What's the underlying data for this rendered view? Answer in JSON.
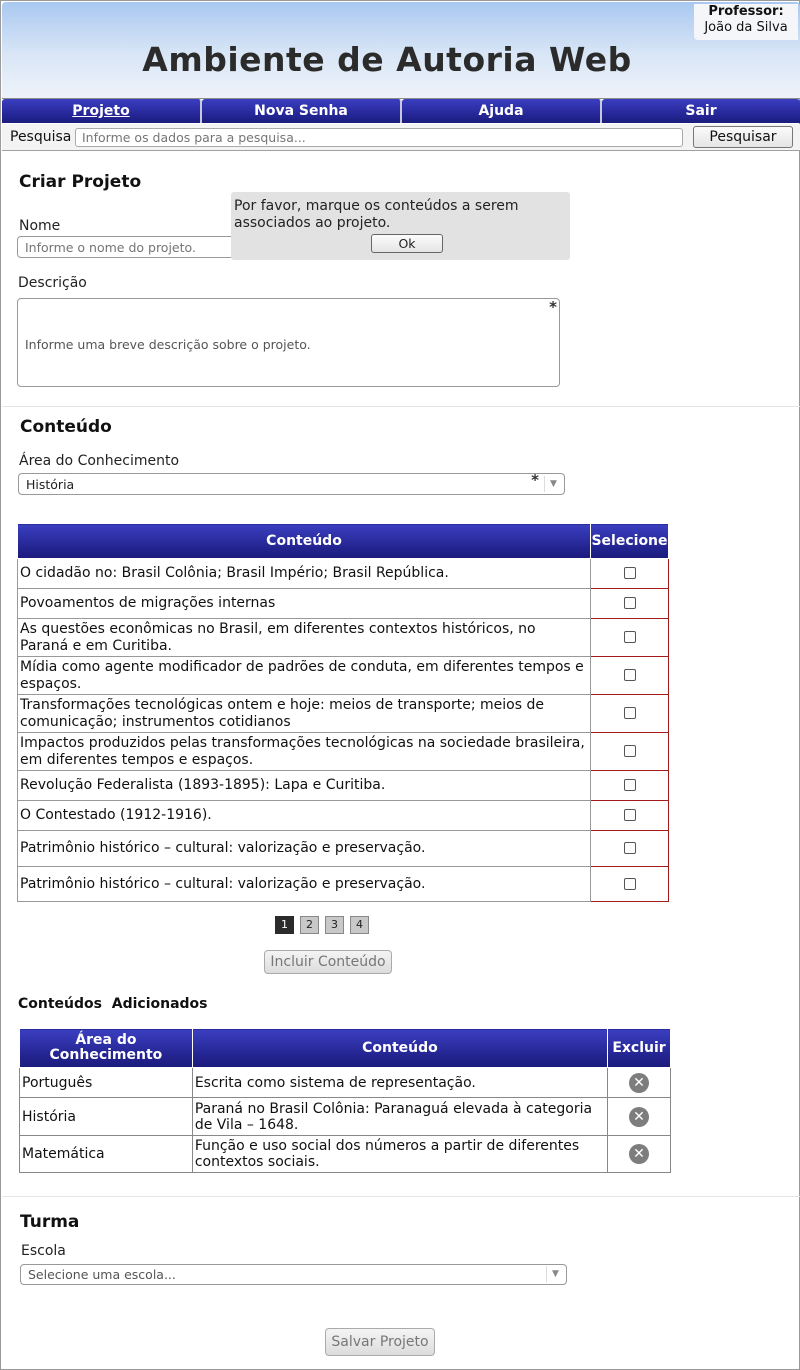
{
  "header": {
    "title": "Ambiente de Autoria Web",
    "professor_label": "Professor:",
    "professor_name": "João da Silva"
  },
  "nav": {
    "items": [
      {
        "label": "Projeto"
      },
      {
        "label": "Nova Senha"
      },
      {
        "label": "Ajuda"
      },
      {
        "label": "Sair"
      }
    ]
  },
  "search": {
    "label": "Pesquisa",
    "placeholder": "Informe os dados para a pesquisa...",
    "button": "Pesquisar"
  },
  "criar": {
    "title": "Criar Projeto",
    "nome_label": "Nome",
    "nome_placeholder": "Informe o nome do projeto.",
    "descricao_label": "Descrição",
    "descricao_placeholder": "Informe uma breve descrição sobre o projeto.",
    "required_mark": "*"
  },
  "popup": {
    "message": "Por favor, marque os conteúdos a serem associados ao projeto.",
    "ok": "Ok"
  },
  "conteudo": {
    "title": "Conteúdo",
    "area_label": "Área do Conhecimento",
    "area_value": "História",
    "table_headers": [
      "Conteúdo",
      "Selecione"
    ],
    "rows": [
      "O cidadão no: Brasil Colônia; Brasil Império; Brasil República.",
      "Povoamentos de migrações internas",
      "As questões econômicas no Brasil, em diferentes contextos históricos, no Paraná e em Curitiba.",
      "Mídia como agente modificador de padrões de conduta, em diferentes tempos e espaços.",
      "Transformações tecnológicas ontem e hoje: meios de transporte; meios de comunicação; instrumentos cotidianos",
      "Impactos produzidos pelas transformações tecnológicas na sociedade brasileira, em diferentes tempos e espaços.",
      "Revolução Federalista (1893-1895): Lapa e Curitiba.",
      "O Contestado (1912-1916).",
      "Patrimônio histórico – cultural: valorização e preservação.",
      "Patrimônio histórico – cultural: valorização e preservação."
    ],
    "pages": [
      "1",
      "2",
      "3",
      "4"
    ],
    "include_button": "Incluir Conteúdo"
  },
  "adicionados": {
    "title": "Conteúdos  Adicionados",
    "headers": [
      "Área do Conhecimento",
      "Conteúdo",
      "Excluir"
    ],
    "rows": [
      {
        "area": "Português",
        "conteudo": "Escrita como sistema de representação."
      },
      {
        "area": "História",
        "conteudo": "Paraná no Brasil Colônia: Paranaguá elevada à categoria de Vila – 1648."
      },
      {
        "area": "Matemática",
        "conteudo": "Função e uso social dos números a partir de diferentes contextos sociais."
      }
    ],
    "delete_icon": "✕"
  },
  "turma": {
    "title": "Turma",
    "escola_label": "Escola",
    "escola_placeholder": "Selecione uma escola..."
  },
  "save_button": "Salvar Projeto",
  "icons": {
    "dropdown_arrow": "▼"
  }
}
